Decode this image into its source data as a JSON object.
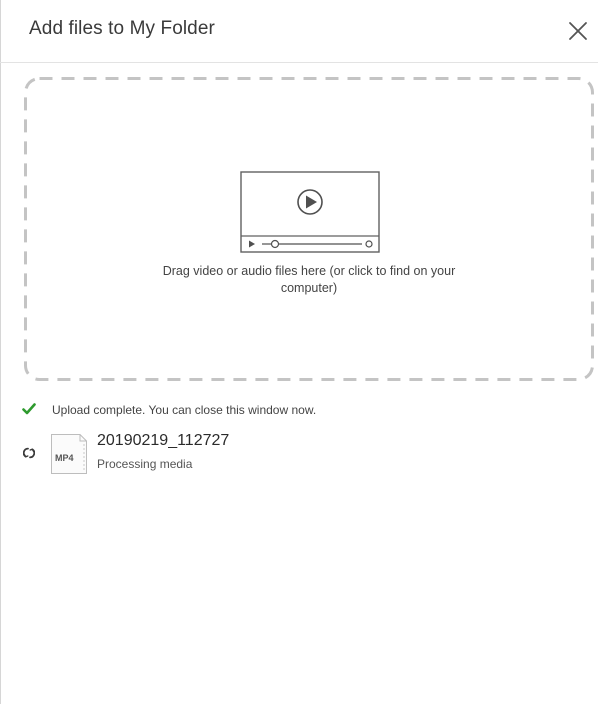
{
  "dialog": {
    "title": "Add files to My Folder",
    "close_icon": "close-icon"
  },
  "dropzone": {
    "icon": "video-player-icon",
    "instructions": "Drag video or audio files here (or click to find on your computer)"
  },
  "upload_status": {
    "icon": "check-icon",
    "message": "Upload complete. You can close this window now."
  },
  "files": [
    {
      "status_icon": "processing-spinner-icon",
      "type_badge": "MP4",
      "name": "20190219_112727",
      "status": "Processing media"
    }
  ],
  "colors": {
    "success": "#2e9a2e",
    "dashed_border": "#c4c4c4",
    "title_text": "#3a3a3a"
  }
}
